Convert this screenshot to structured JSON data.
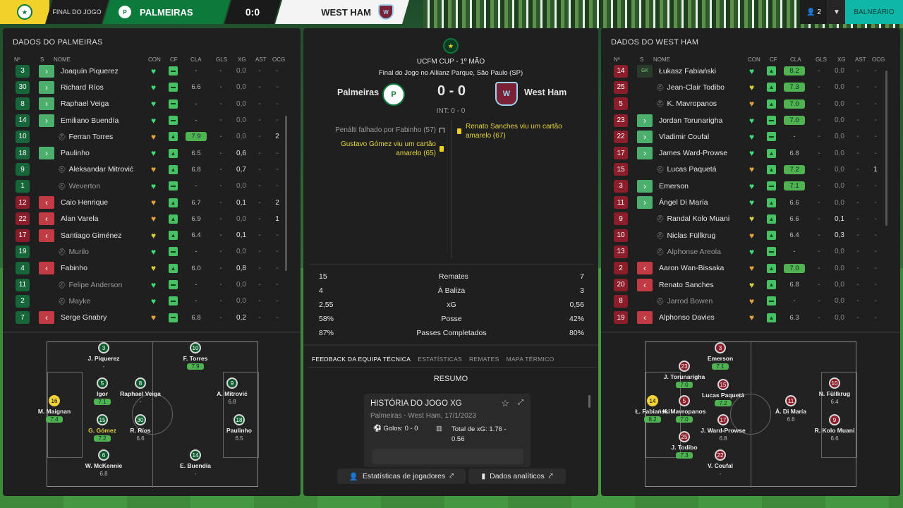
{
  "header": {
    "status": "FINAL DO JOGO",
    "home_team": "PALMEIRAS",
    "score": "0:0",
    "away_team": "WEST HAM",
    "users": "2",
    "lounge_button": "BALNEÁRIO"
  },
  "home_panel": {
    "title": "DADOS DO PALMEIRAS",
    "columns": [
      "Nº",
      "S",
      "NOME",
      "CON",
      "CF",
      "CLA",
      "GLS",
      "XG",
      "AST",
      "OCG"
    ],
    "rows": [
      {
        "num": "3",
        "sub": "in",
        "name": "Joaquín Piquerez",
        "cf": "-",
        "cla": "-",
        "xg": "0,0",
        "ast": "-",
        "ocg": "-",
        "color": "g",
        "con": "green"
      },
      {
        "num": "30",
        "sub": "in",
        "name": "Richard Ríos",
        "cf": "-",
        "cla": "6.6",
        "xg": "0,0",
        "ast": "-",
        "ocg": "-",
        "color": "g",
        "con": "green"
      },
      {
        "num": "8",
        "sub": "in",
        "name": "Raphael Veiga",
        "cf": "-",
        "cla": "-",
        "xg": "0,0",
        "ast": "-",
        "ocg": "-",
        "color": "g",
        "con": "green"
      },
      {
        "num": "14",
        "sub": "in",
        "name": "Emiliano Buendía",
        "cf": "-",
        "cla": "-",
        "xg": "0,0",
        "ast": "-",
        "ocg": "-",
        "color": "g",
        "con": "green"
      },
      {
        "num": "10",
        "sub": "",
        "name": "Ferran Torres",
        "cf": "+",
        "cla": "7.9",
        "xg": "0,0",
        "ast": "-",
        "ocg": "2",
        "color": "g",
        "con": "orange",
        "hi": true
      },
      {
        "num": "18",
        "sub": "in",
        "name": "Paulinho",
        "cf": "+",
        "cla": "6.5",
        "xg": "0,6",
        "ast": "-",
        "ocg": "-",
        "color": "g",
        "con": "green"
      },
      {
        "num": "9",
        "sub": "",
        "name": "Aleksandar Mitrović",
        "cf": "+",
        "cla": "6.8",
        "xg": "0,7",
        "ast": "-",
        "ocg": "-",
        "color": "g",
        "con": "orange"
      },
      {
        "num": "1",
        "sub": "",
        "name": "Weverton",
        "cf": "-",
        "cla": "-",
        "xg": "0,0",
        "ast": "-",
        "ocg": "-",
        "color": "g",
        "con": "green",
        "dim": true
      },
      {
        "num": "12",
        "sub": "out",
        "name": "Caio Henrique",
        "cf": "+",
        "cla": "6.7",
        "xg": "0,1",
        "ast": "-",
        "ocg": "2",
        "color": "r",
        "con": "orange"
      },
      {
        "num": "22",
        "sub": "out",
        "name": "Alan Varela",
        "cf": "+",
        "cla": "6.9",
        "xg": "0,0",
        "ast": "-",
        "ocg": "1",
        "color": "r",
        "con": "orange"
      },
      {
        "num": "17",
        "sub": "out",
        "name": "Santiago Giménez",
        "cf": "+",
        "cla": "6.4",
        "xg": "0,1",
        "ast": "-",
        "ocg": "-",
        "color": "r",
        "con": "yellow"
      },
      {
        "num": "19",
        "sub": "",
        "name": "Murilo",
        "cf": "-",
        "cla": "-",
        "xg": "0,0",
        "ast": "-",
        "ocg": "-",
        "color": "g",
        "con": "green",
        "dim": true
      },
      {
        "num": "4",
        "sub": "out",
        "name": "Fabinho",
        "cf": "+",
        "cla": "6.0",
        "xg": "0,8",
        "ast": "-",
        "ocg": "-",
        "color": "g",
        "con": "yellow"
      },
      {
        "num": "11",
        "sub": "",
        "name": "Felipe Anderson",
        "cf": "-",
        "cla": "-",
        "xg": "0,0",
        "ast": "-",
        "ocg": "-",
        "color": "g",
        "con": "green",
        "dim": true
      },
      {
        "num": "2",
        "sub": "",
        "name": "Mayke",
        "cf": "-",
        "cla": "-",
        "xg": "0,0",
        "ast": "-",
        "ocg": "-",
        "color": "g",
        "con": "green",
        "dim": true
      },
      {
        "num": "7",
        "sub": "out",
        "name": "Serge Gnabry",
        "cf": "-",
        "cla": "6.8",
        "xg": "0,2",
        "ast": "-",
        "ocg": "-",
        "color": "g",
        "con": "orange"
      }
    ]
  },
  "away_panel": {
    "title": "DADOS DO WEST HAM",
    "rows": [
      {
        "num": "14",
        "sub": "gk",
        "name": "Łukasz Fabiański",
        "cf": "+",
        "cla": "8.2",
        "xg": "0,0",
        "ast": "-",
        "ocg": "-",
        "color": "r",
        "con": "green",
        "hi": true
      },
      {
        "num": "25",
        "sub": "",
        "name": "Jean-Clair Todibo",
        "cf": "+",
        "cla": "7.3",
        "xg": "0,0",
        "ast": "-",
        "ocg": "-",
        "color": "r",
        "con": "yellow",
        "hi": true
      },
      {
        "num": "5",
        "sub": "",
        "name": "K. Mavropanos",
        "cf": "+",
        "cla": "7.0",
        "xg": "0,0",
        "ast": "-",
        "ocg": "-",
        "color": "r",
        "con": "orange",
        "hi": true
      },
      {
        "num": "23",
        "sub": "in",
        "name": "Jordan Torunarigha",
        "cf": "-",
        "cla": "7.0",
        "xg": "0,0",
        "ast": "-",
        "ocg": "-",
        "color": "r",
        "con": "green",
        "hi": true
      },
      {
        "num": "22",
        "sub": "in",
        "name": "Vladimir Coufal",
        "cf": "-",
        "cla": "-",
        "xg": "0,0",
        "ast": "-",
        "ocg": "-",
        "color": "r",
        "con": "green"
      },
      {
        "num": "17",
        "sub": "in",
        "name": "James Ward-Prowse",
        "cf": "+",
        "cla": "6.8",
        "xg": "0,0",
        "ast": "-",
        "ocg": "-",
        "color": "r",
        "con": "green"
      },
      {
        "num": "15",
        "sub": "",
        "name": "Lucas Paquetá",
        "cf": "+",
        "cla": "7.2",
        "xg": "0,0",
        "ast": "-",
        "ocg": "1",
        "color": "r",
        "con": "orange",
        "hi": true
      },
      {
        "num": "3",
        "sub": "in",
        "name": "Emerson",
        "cf": "-",
        "cla": "7.1",
        "xg": "0,0",
        "ast": "-",
        "ocg": "-",
        "color": "r",
        "con": "green",
        "hi": true
      },
      {
        "num": "11",
        "sub": "in",
        "name": "Ángel Di María",
        "cf": "+",
        "cla": "6.6",
        "xg": "0,0",
        "ast": "-",
        "ocg": "-",
        "color": "r",
        "con": "green"
      },
      {
        "num": "9",
        "sub": "",
        "name": "Randal Kolo Muani",
        "cf": "+",
        "cla": "6.6",
        "xg": "0,1",
        "ast": "-",
        "ocg": "-",
        "color": "r",
        "con": "yellow"
      },
      {
        "num": "10",
        "sub": "",
        "name": "Niclas Füllkrug",
        "cf": "+",
        "cla": "6.4",
        "xg": "0,3",
        "ast": "-",
        "ocg": "-",
        "color": "r",
        "con": "orange"
      },
      {
        "num": "13",
        "sub": "",
        "name": "Alphonse Areola",
        "cf": "-",
        "cla": "-",
        "xg": "0,0",
        "ast": "-",
        "ocg": "-",
        "color": "r",
        "con": "green",
        "dim": true
      },
      {
        "num": "2",
        "sub": "out",
        "name": "Aaron Wan-Bissaka",
        "cf": "+",
        "cla": "7.0",
        "xg": "0,0",
        "ast": "-",
        "ocg": "-",
        "color": "r",
        "con": "orange",
        "hi": true
      },
      {
        "num": "20",
        "sub": "out",
        "name": "Renato Sanches",
        "cf": "+",
        "cla": "6.8",
        "xg": "0,0",
        "ast": "-",
        "ocg": "-",
        "color": "r",
        "con": "yellow"
      },
      {
        "num": "8",
        "sub": "",
        "name": "Jarrod Bowen",
        "cf": "-",
        "cla": "-",
        "xg": "0,0",
        "ast": "-",
        "ocg": "-",
        "color": "r",
        "con": "orange",
        "dim": true
      },
      {
        "num": "19",
        "sub": "out",
        "name": "Alphonso Davies",
        "cf": "+",
        "cla": "6.3",
        "xg": "0,0",
        "ast": "-",
        "ocg": "-",
        "color": "r",
        "con": "orange"
      }
    ]
  },
  "match": {
    "competition": "UCFM CUP - 1º MÃO",
    "venue": "Final do Jogo no Allianz Parque, São Paulo (SP)",
    "home": "Palmeiras",
    "away": "West Ham",
    "score": "0 - 0",
    "halftime": "INT: 0 - 0",
    "events_home": [
      {
        "text": "Penálti falhado por Fabinho (57)"
      },
      {
        "text": "Gustavo Gómez viu um cartão amarelo (65)"
      }
    ],
    "events_away": [
      {
        "text": "Renato Sanches viu um cartão amarelo (67)"
      }
    ]
  },
  "stats": [
    {
      "label": "Remates",
      "home": "15",
      "away": "7"
    },
    {
      "label": "À Baliza",
      "home": "4",
      "away": "3"
    },
    {
      "label": "xG",
      "home": "2,55",
      "away": "0,56"
    },
    {
      "label": "Posse",
      "home": "58%",
      "away": "42%"
    },
    {
      "label": "Passes Completados",
      "home": "87%",
      "away": "80%"
    }
  ],
  "tabs": [
    "FEEDBACK DA EQUIPA TÉCNICA",
    "ESTATÍSTICAS",
    "REMATES",
    "MAPA TÉRMICO"
  ],
  "summary": {
    "title": "RESUMO",
    "card_title": "HISTÓRIA DO JOGO XG",
    "card_sub": "Palmeiras - West Ham, 17/1/2023",
    "goals": "Golos: 0 - 0",
    "xg_total": "Total de xG: 1.76 - 0.56"
  },
  "buttons": {
    "player_stats": "Estatísticas de jogadores",
    "analytics": "Dados analíticos"
  },
  "home_formation": [
    {
      "n": "3",
      "name": "J. Piquerez",
      "rt": "-"
    },
    {
      "n": "10",
      "name": "F. Torres",
      "rt": "7.9",
      "hi": true
    },
    {
      "n": "16",
      "name": "M. Maignan",
      "rt": "7.4",
      "hi": true,
      "gk": true
    },
    {
      "n": "5",
      "name": "Igor",
      "rt": "7.1",
      "hi": true
    },
    {
      "n": "8",
      "name": "Raphael Veiga",
      "rt": "-"
    },
    {
      "n": "9",
      "name": "A. Mitrović",
      "rt": "6.8"
    },
    {
      "n": "15",
      "name": "G. Gómez",
      "rt": "7.2",
      "hi": true,
      "yellow": true
    },
    {
      "n": "30",
      "name": "R. Ríos",
      "rt": "6.6"
    },
    {
      "n": "18",
      "name": "Paulinho",
      "rt": "6.5"
    },
    {
      "n": "6",
      "name": "W. McKennie",
      "rt": "6.8"
    },
    {
      "n": "14",
      "name": "E. Buendía",
      "rt": "-"
    }
  ],
  "away_formation": [
    {
      "n": "3",
      "name": "Emerson",
      "rt": "7.1",
      "hi": true
    },
    {
      "n": "23",
      "name": "J. Torunarigha",
      "rt": "7.0",
      "hi": true
    },
    {
      "n": "15",
      "name": "Lucas Paquetá",
      "rt": "7.2",
      "hi": true
    },
    {
      "n": "14",
      "name": "Ł. Fabiański",
      "rt": "8.2",
      "hi": true,
      "gk": true
    },
    {
      "n": "5",
      "name": "K. Mavropanos",
      "rt": "7.0",
      "hi": true
    },
    {
      "n": "11",
      "name": "Á. Di María",
      "rt": "6.6"
    },
    {
      "n": "10",
      "name": "N. Füllkrug",
      "rt": "6.4"
    },
    {
      "n": "17",
      "name": "J. Ward-Prowse",
      "rt": "6.8"
    },
    {
      "n": "9",
      "name": "R. Kolo Muani",
      "rt": "6.6"
    },
    {
      "n": "25",
      "name": "J. Todibo",
      "rt": "7.3",
      "hi": true
    },
    {
      "n": "22",
      "name": "V. Coufal",
      "rt": "-"
    }
  ]
}
